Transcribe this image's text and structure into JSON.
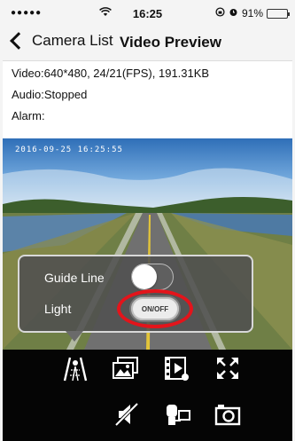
{
  "status_bar": {
    "signal": "●●●●●",
    "time": "16:25",
    "battery_percent": "91%",
    "battery_level": 0.91
  },
  "nav": {
    "back_label": "Camera List",
    "title": "Video Preview"
  },
  "info": {
    "video": "Video:640*480, 24/21(FPS), 191.31KB",
    "audio": "Audio:Stopped",
    "alarm": "Alarm:"
  },
  "video": {
    "timestamp": "2016-09-25 16:25:55"
  },
  "popup": {
    "guide_line_label": "Guide Line",
    "guide_line_on": false,
    "light_label": "Light",
    "light_button_label": "ON/OFF"
  },
  "toolbar": {
    "icons": [
      "guide-line-icon",
      "gallery-icon",
      "video-record-icon",
      "fullscreen-icon",
      "mute-icon",
      "camera-switch-icon",
      "snapshot-icon"
    ]
  },
  "colors": {
    "highlight_ring": "#e3141b",
    "battery": "#4cd964",
    "toolbar_bg": "#050505"
  }
}
